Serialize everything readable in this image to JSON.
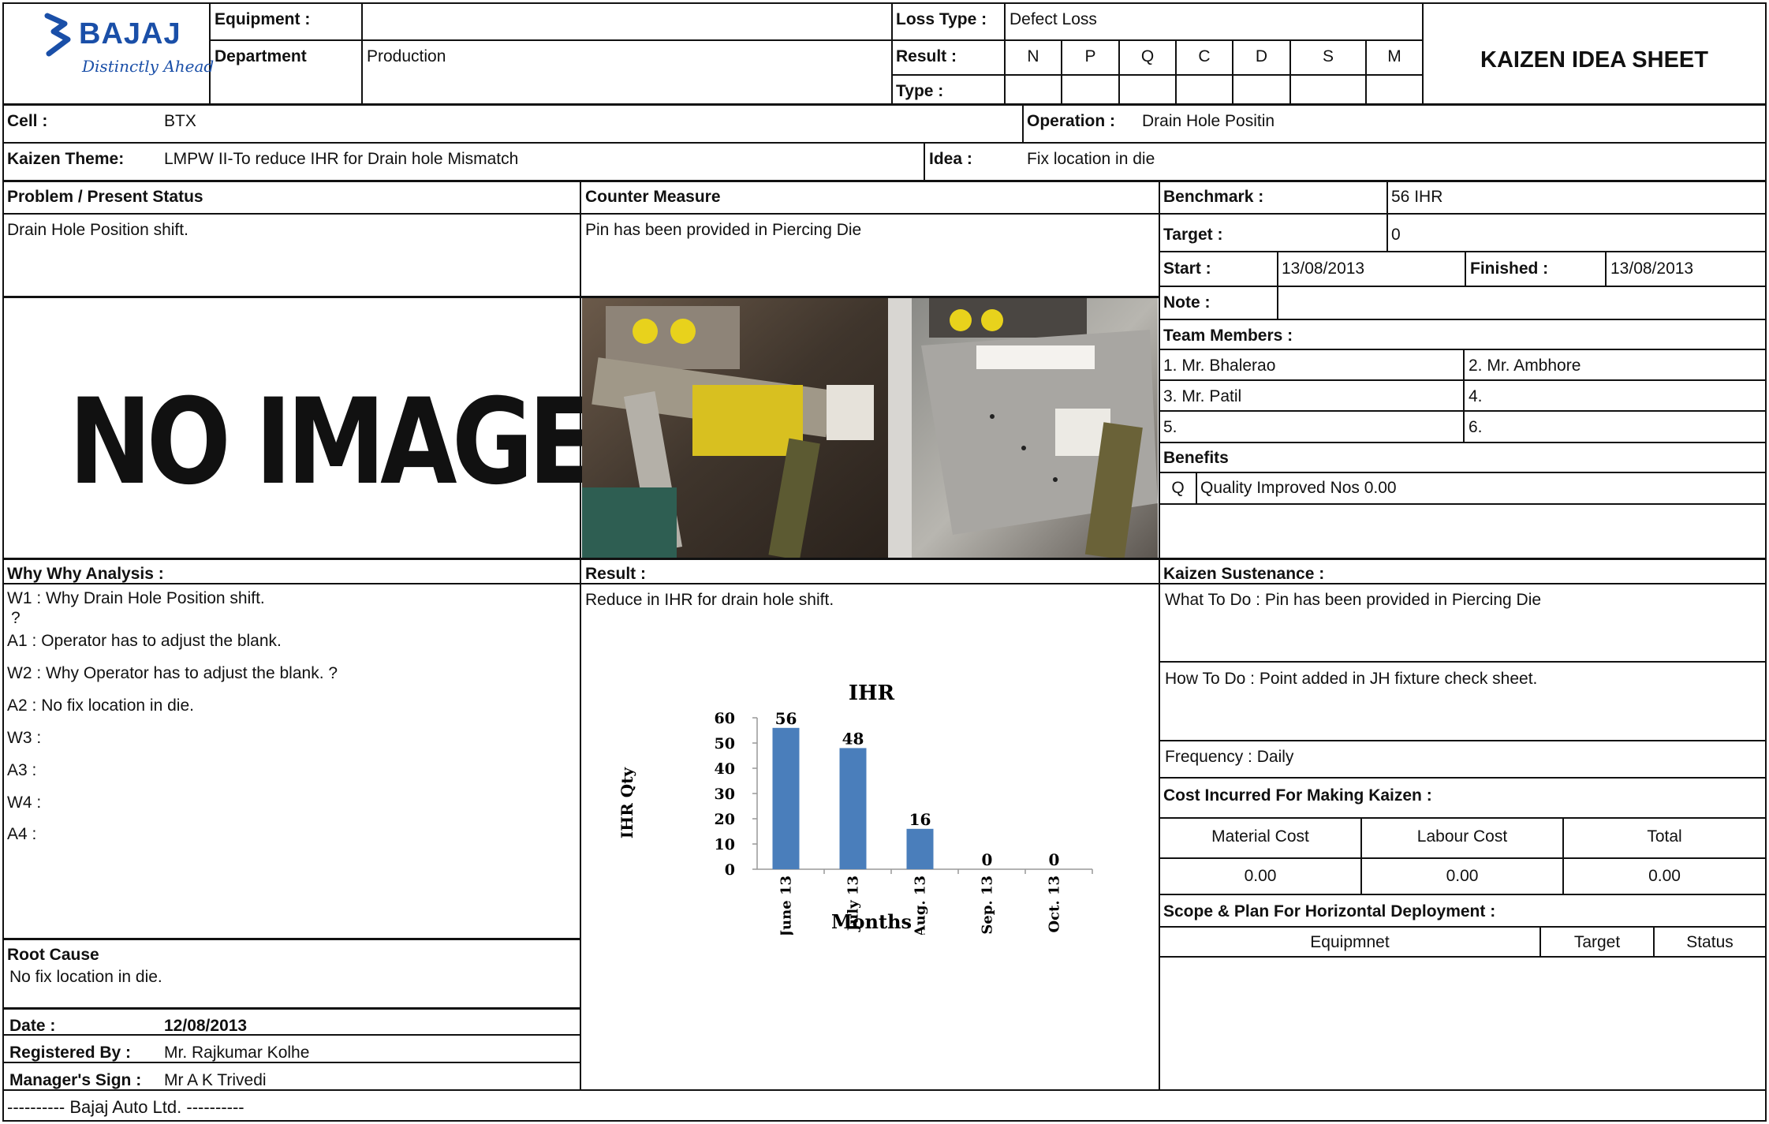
{
  "header": {
    "logo_text": "BAJAJ",
    "logo_tagline": "Distinctly Ahead",
    "equipment_label": "Equipment :",
    "equipment_value": "",
    "department_label": "Department",
    "department_value": "Production",
    "loss_type_label": "Loss Type :",
    "loss_type_value": "Defect Loss",
    "result_label": "Result :",
    "type_label": "Type :",
    "result_codes": [
      "N",
      "P",
      "Q",
      "C",
      "D",
      "S",
      "M"
    ],
    "sheet_title": "KAIZEN IDEA SHEET"
  },
  "row_cell": {
    "cell_label": "Cell :",
    "cell_value": "BTX",
    "operation_label": "Operation :",
    "operation_value": "Drain Hole Positin"
  },
  "row_theme": {
    "theme_label": "Kaizen Theme:",
    "theme_value": "LMPW II-To reduce IHR for  Drain hole Mismatch",
    "idea_label": "Idea :",
    "idea_value": "Fix location in die"
  },
  "problem": {
    "heading": "Problem / Present Status",
    "text": "Drain Hole Position shift.",
    "no_image_text": "NO IMAGE"
  },
  "counter": {
    "heading": "Counter Measure",
    "text": "Pin has been provided in Piercing Die"
  },
  "info": {
    "benchmark_label": "Benchmark :",
    "benchmark_value": "56 IHR",
    "target_label": "Target :",
    "target_value": "0",
    "start_label": "Start :",
    "start_value": "13/08/2013",
    "finished_label": "Finished :",
    "finished_value": "13/08/2013",
    "note_label": "Note :",
    "note_value": "",
    "team_label": "Team Members :",
    "members": [
      "1. Mr. Bhalerao",
      "2. Mr. Ambhore",
      "3. Mr. Patil",
      "4.",
      "5.",
      "6."
    ],
    "benefits_label": "Benefits",
    "benefit_code": "Q",
    "benefit_text": "Quality Improved Nos 0.00"
  },
  "why": {
    "heading": "Why Why Analysis :",
    "w1": "W1 : Why Drain Hole Position shift.",
    "w1_cont": "?",
    "a1": "A1 : Operator has to adjust the blank.",
    "w2": "W2 : Why Operator has to adjust the blank. ?",
    "a2": "A2 : No fix location in die.",
    "w3": "W3 :",
    "a3": "A3 :",
    "w4": "W4 :",
    "a4": "A4 :"
  },
  "root": {
    "heading": "Root Cause",
    "text": "No fix location in die."
  },
  "footer_left": {
    "date_label": "Date :",
    "date_value": "12/08/2013",
    "registered_label": "Registered By :",
    "registered_value": "Mr. Rajkumar Kolhe",
    "manager_label": "Manager's Sign :",
    "manager_value": "Mr A K Trivedi",
    "company_line": "---------- Bajaj Auto Ltd.  ----------"
  },
  "result": {
    "heading": "Result :",
    "text": "Reduce in IHR for drain hole shift."
  },
  "chart_data": {
    "type": "bar",
    "title": "IHR",
    "xlabel": "Months",
    "ylabel": "IHR Qty",
    "categories": [
      "June 13",
      "July 13",
      "Aug. 13",
      "Sep. 13",
      "Oct. 13"
    ],
    "values": [
      56,
      48,
      16,
      0,
      0
    ],
    "ylim": [
      0,
      60
    ],
    "yticks": [
      "0",
      "10",
      "20",
      "30",
      "40",
      "50",
      "60"
    ],
    "bar_color": "#4a7ebb",
    "grid": false
  },
  "sustenance": {
    "heading": "Kaizen Sustenance :",
    "what": "What To Do : Pin has been provided in Piercing Die",
    "how": "How To Do : Point added in JH fixture check  sheet.",
    "frequency": "Frequency : Daily",
    "cost_heading": "Cost Incurred For Making Kaizen  :",
    "cost_headers": [
      "Material Cost",
      "Labour Cost",
      "Total"
    ],
    "cost_values": [
      "0.00",
      "0.00",
      "0.00"
    ],
    "scope_heading": "Scope & Plan For Horizontal Deployment :",
    "scope_headers": [
      "Equipmnet",
      "Target",
      "Status"
    ]
  }
}
